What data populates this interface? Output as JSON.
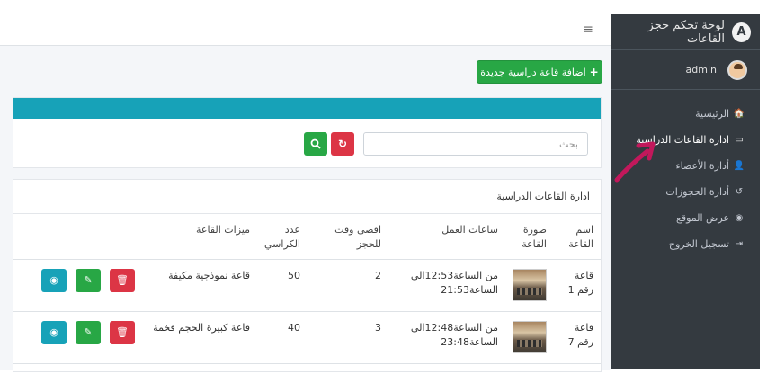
{
  "sidebar": {
    "brand_title": "لوحة تحكم حجز القاعات",
    "user_name": "admin",
    "items": [
      {
        "label": "الرئيسية",
        "icon": "home-icon",
        "glyph": "🏠"
      },
      {
        "label": "ادارة القاعات الدراسية",
        "icon": "chalkboard-icon",
        "glyph": "▭"
      },
      {
        "label": "أدارة الأعضاء",
        "icon": "user-icon",
        "glyph": "👤"
      },
      {
        "label": "أدارة الحجوزات",
        "icon": "history-icon",
        "glyph": "↺"
      },
      {
        "label": "عرض الموقع",
        "icon": "eye-icon",
        "glyph": "◉"
      },
      {
        "label": "تسجيل الخروج",
        "icon": "sign-out-icon",
        "glyph": "⇥"
      }
    ]
  },
  "topbar": {
    "menu_glyph": "≡"
  },
  "toolbar": {
    "add_label": "اضافة قاعة دراسية جديدة",
    "add_glyph": "+"
  },
  "search": {
    "placeholder": "بحث",
    "value": ""
  },
  "table": {
    "title": "ادارة القاعات الدراسية",
    "headers": {
      "name": "اسم القاعة",
      "image": "صورة القاعة",
      "hours": "ساعات العمل",
      "max_time": "اقصى وقت للحجز",
      "seats": "عدد الكراسي",
      "features": "ميزات القاعة"
    },
    "rows": [
      {
        "name": "قاعة رقم 1",
        "hours": "من الساعة12:53الى الساعة21:53",
        "max_time": "2",
        "seats": "50",
        "features": "قاعة نموذجية مكيفة"
      },
      {
        "name": "قاعة رقم 7",
        "hours": "من الساعة12:48الى الساعة23:48",
        "max_time": "3",
        "seats": "40",
        "features": "قاعة كبيرة الحجم فخمة"
      }
    ]
  },
  "colors": {
    "sidebar_bg": "#343a40",
    "success": "#28a745",
    "danger": "#dc3545",
    "info": "#17a2b8",
    "annotation_arrow": "#c2185b"
  }
}
